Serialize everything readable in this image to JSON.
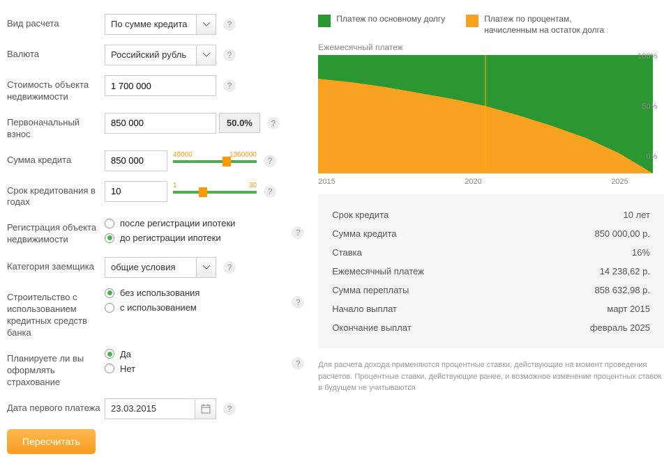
{
  "form": {
    "calc_type_label": "Вид расчета",
    "calc_type_value": "По сумме кредита",
    "currency_label": "Валюта",
    "currency_value": "Российский рубль",
    "property_cost_label": "Стоимость объекта недвижимости",
    "property_cost_value": "1 700 000",
    "down_payment_label": "Первоначальный взнос",
    "down_payment_value": "850 000",
    "down_payment_pct": "50.0%",
    "loan_amount_label": "Сумма кредита",
    "loan_amount_value": "850 000",
    "loan_amount_slider": {
      "min": "45000",
      "max": "1360000",
      "pos": 59
    },
    "term_label": "Срок кредитования в годах",
    "term_value": "10",
    "term_slider": {
      "min": "1",
      "max": "30",
      "pos": 31
    },
    "registration_label": "Регистрация объекта недвижимости",
    "registration_opt_after": "после регистрации ипотеки",
    "registration_opt_before": "до регистрации ипотеки",
    "registration_selected": "before",
    "category_label": "Категория заемщика",
    "category_value": "общие условия",
    "construction_label": "Строительство с использованием кредитных средств банка",
    "construction_opt_without": "без использования",
    "construction_opt_with": "с использованием",
    "construction_selected": "without",
    "insurance_label": "Планируете ли вы оформлять страхование",
    "insurance_opt_yes": "Да",
    "insurance_opt_no": "Нет",
    "insurance_selected": "yes",
    "first_payment_date_label": "Дата первого платежа",
    "first_payment_date_value": "23.03.2015",
    "recalc_button": "Пересчитать"
  },
  "chart_data": {
    "type": "area",
    "title": "Ежемесячный платеж",
    "legend": {
      "principal": {
        "label": "Платеж по основному долгу",
        "color": "#2a9733"
      },
      "interest": {
        "label": "Платеж по процентам, начисленным на остаток долга",
        "color": "#f7a120"
      }
    },
    "x_ticks": [
      "2015",
      "2020",
      "2025"
    ],
    "y_ticks": [
      "100%",
      "50%",
      "0%"
    ],
    "xlim": [
      2015,
      2025
    ],
    "ylim": [
      0,
      100
    ],
    "series": [
      {
        "name": "Платеж по процентам",
        "color": "#f7a120",
        "x": [
          2015,
          2016,
          2017,
          2018,
          2019,
          2020,
          2021,
          2022,
          2023,
          2024,
          2025
        ],
        "values": [
          80,
          77,
          73,
          68,
          63,
          57,
          49,
          40,
          30,
          17,
          0
        ]
      },
      {
        "name": "Платеж по основному долгу",
        "color": "#2a9733",
        "x": [
          2015,
          2016,
          2017,
          2018,
          2019,
          2020,
          2021,
          2022,
          2023,
          2024,
          2025
        ],
        "values": [
          20,
          23,
          27,
          32,
          37,
          43,
          51,
          60,
          70,
          83,
          100
        ]
      }
    ]
  },
  "results": {
    "term_label": "Срок кредита",
    "term_value": "10 лет",
    "amount_label": "Сумма кредита",
    "amount_value": "850 000,00 р.",
    "rate_label": "Ставка",
    "rate_value": "16%",
    "monthly_label": "Ежемесячный платеж",
    "monthly_value": "14 238,62 р.",
    "overpay_label": "Сумма переплаты",
    "overpay_value": "858 632,98 р.",
    "start_label": "Начало выплат",
    "start_value": "март 2015",
    "end_label": "Окончание выплат",
    "end_value": "февраль 2025"
  },
  "footnote": "Для расчета дохода применяются процентные ставки, действующие на момент проведения расчетов. Процентные ставки, действующие ранее, и возможное изменение процентных ставок в будущем не учитываются"
}
